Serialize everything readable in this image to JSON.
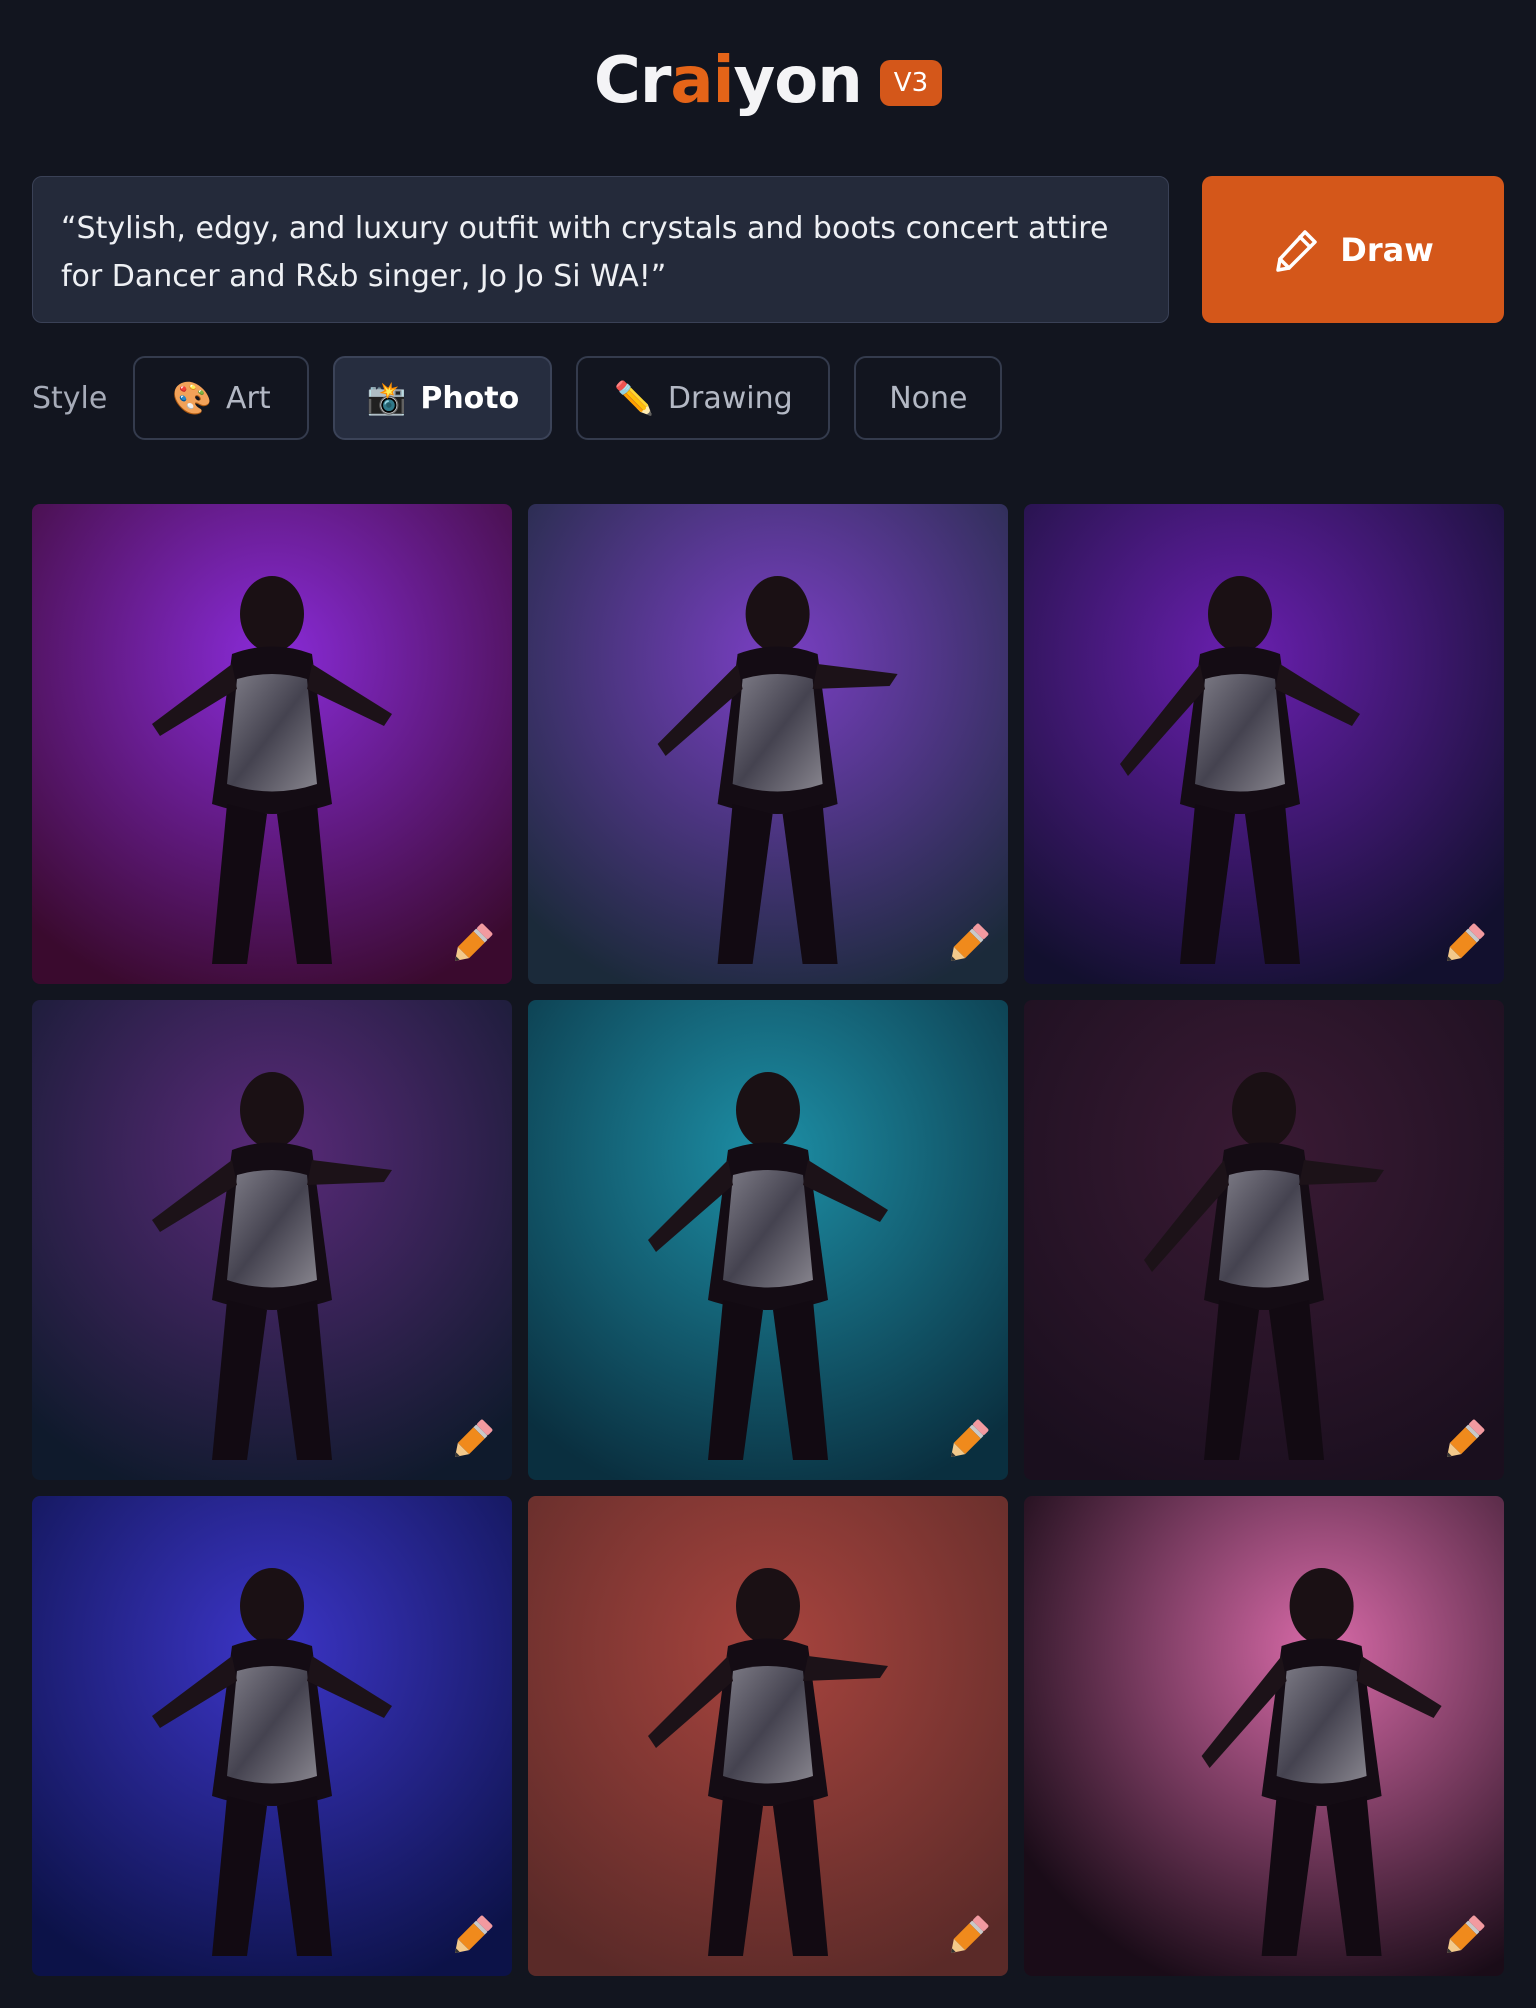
{
  "header": {
    "logo_pre": "Cr",
    "logo_ai": "ai",
    "logo_post": "yon",
    "version": "V3"
  },
  "prompt": {
    "text": "“Stylish, edgy, and luxury outfit with crystals and boots concert attire for Dancer and R&b singer, Jo Jo Si WA!”"
  },
  "draw_button": {
    "label": "Draw",
    "icon": "pencil-icon"
  },
  "style": {
    "label": "Style",
    "options": [
      {
        "label": "Art",
        "icon": "🎨",
        "active": false
      },
      {
        "label": "Photo",
        "icon": "📸",
        "active": true
      },
      {
        "label": "Drawing",
        "icon": "✏️",
        "active": false
      },
      {
        "label": "None",
        "icon": "",
        "active": false
      }
    ]
  },
  "images": [
    {
      "theme": "purple-spotlight-figure",
      "colors": [
        "#3a0a2e",
        "#8a2bd9"
      ]
    },
    {
      "theme": "crystal-gown-stage-audience",
      "colors": [
        "#1b2a3a",
        "#7a3fc4"
      ]
    },
    {
      "theme": "purple-jeweled-performer",
      "colors": [
        "#12102e",
        "#6a1fb0"
      ]
    },
    {
      "theme": "silver-sequin-dancers",
      "colors": [
        "#0f1a2c",
        "#5a2a7a"
      ]
    },
    {
      "theme": "teal-spotlight-dress",
      "colors": [
        "#0a2f3f",
        "#1d8fa6"
      ]
    },
    {
      "theme": "crystal-bodysuit-dark",
      "colors": [
        "#1a0f1e",
        "#3a1a34"
      ]
    },
    {
      "theme": "blue-stage-lights",
      "colors": [
        "#0c1248",
        "#3c35c8"
      ]
    },
    {
      "theme": "red-backdrop-sunglasses",
      "colors": [
        "#5a2a28",
        "#a8443e"
      ]
    },
    {
      "theme": "pink-backlit-gown",
      "colors": [
        "#1a0c18",
        "#d86aa8"
      ]
    }
  ]
}
